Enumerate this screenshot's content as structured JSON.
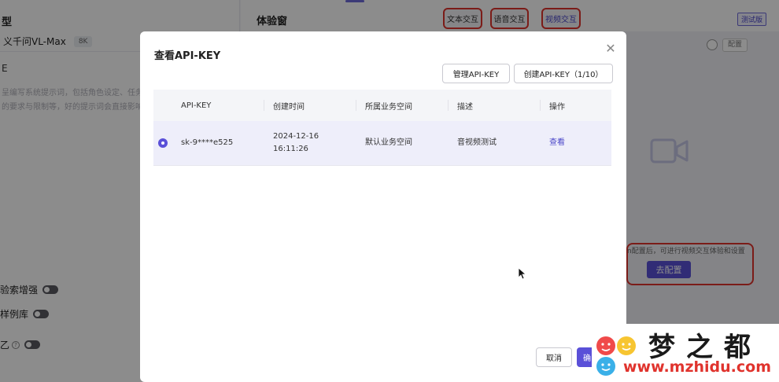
{
  "left_panel": {
    "title": "型",
    "model_name": "义千问VL-Max",
    "model_tag": "8K",
    "section": "E",
    "hint": "呈编写系统提示词，包括角色设定、任务\n的要求与限制等，好的提示词会直接影响",
    "toggles": [
      {
        "label": "验索增强"
      },
      {
        "label": "样例库"
      },
      {
        "label": "乙"
      }
    ]
  },
  "header": {
    "title": "体验窗",
    "modes": [
      {
        "label": "文本交互"
      },
      {
        "label": "语音交互"
      },
      {
        "label": "视频交互"
      }
    ],
    "badge": "测试版"
  },
  "right_pane": {
    "btn_config": "配置",
    "config_hint": "n配置后，可进行视频交互体验和设置",
    "config_button": "去配置"
  },
  "modal": {
    "title": "查看API-KEY",
    "manage_button": "管理API-KEY",
    "create_button": "创建API-KEY（1/10）",
    "columns": [
      "API-KEY",
      "创建时间",
      "所属业务空间",
      "描述",
      "操作"
    ],
    "rows": [
      {
        "api_key": "sk-9****e525",
        "created_date": "2024-12-16",
        "created_time": "16:11:26",
        "workspace": "默认业务空间",
        "description": "音视频测试",
        "action": "查看"
      }
    ],
    "cancel": "取消",
    "confirm": "确"
  },
  "watermark": {
    "text": "梦之都",
    "url": "www.mzhidu.com"
  }
}
